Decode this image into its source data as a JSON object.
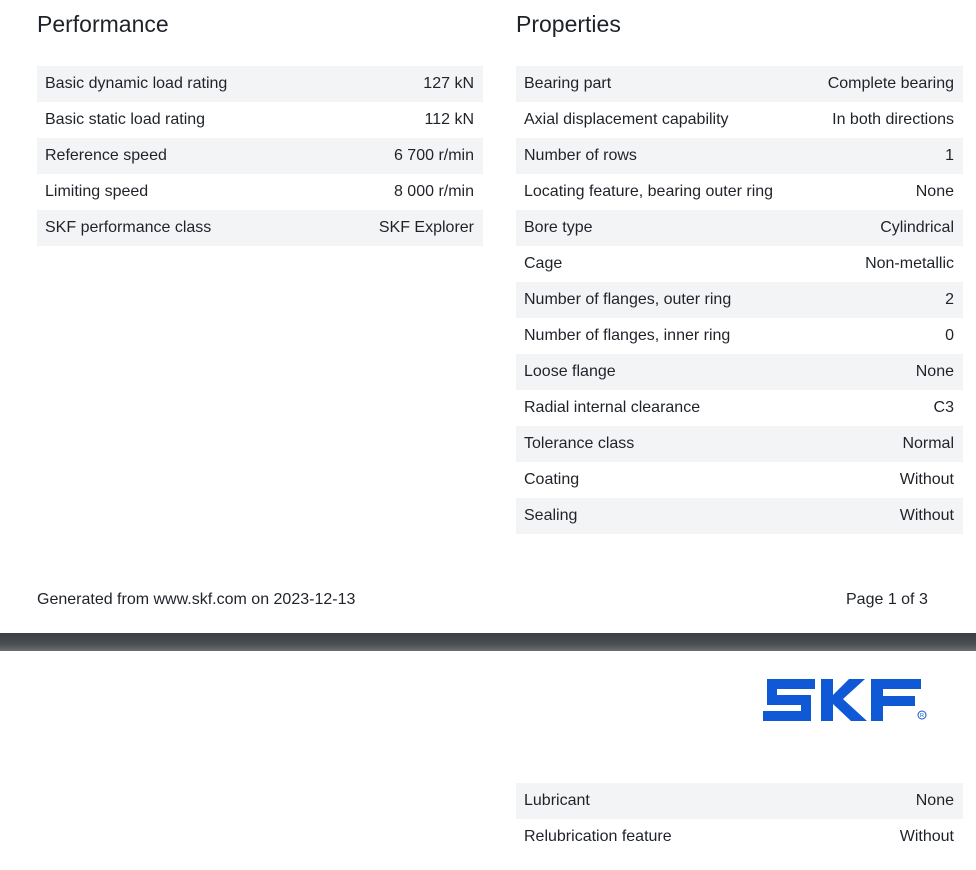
{
  "performance": {
    "title": "Performance",
    "rows": [
      {
        "label": "Basic dynamic load rating",
        "value": "127 kN"
      },
      {
        "label": "Basic static load rating",
        "value": "112 kN"
      },
      {
        "label": "Reference speed",
        "value": "6 700 r/min"
      },
      {
        "label": "Limiting speed",
        "value": "8 000 r/min"
      },
      {
        "label": "SKF performance class",
        "value": "SKF Explorer"
      }
    ]
  },
  "properties": {
    "title": "Properties",
    "rows": [
      {
        "label": "Bearing part",
        "value": "Complete bearing"
      },
      {
        "label": "Axial displacement capability",
        "value": "In both directions"
      },
      {
        "label": "Number of rows",
        "value": "1"
      },
      {
        "label": "Locating feature, bearing outer ring",
        "value": "None"
      },
      {
        "label": "Bore type",
        "value": "Cylindrical"
      },
      {
        "label": "Cage",
        "value": "Non-metallic"
      },
      {
        "label": "Number of flanges, outer ring",
        "value": "2"
      },
      {
        "label": "Number of flanges, inner ring",
        "value": "0"
      },
      {
        "label": "Loose flange",
        "value": "None"
      },
      {
        "label": "Radial internal clearance",
        "value": "C3"
      },
      {
        "label": "Tolerance class",
        "value": "Normal"
      },
      {
        "label": "Coating",
        "value": "Without"
      },
      {
        "label": "Sealing",
        "value": "Without"
      }
    ],
    "continued_rows": [
      {
        "label": "Lubricant",
        "value": "None"
      },
      {
        "label": "Relubrication feature",
        "value": "Without"
      }
    ]
  },
  "footer": {
    "generated": "Generated from www.skf.com on 2023-12-13",
    "page": "Page 1 of 3"
  },
  "logo": {
    "text": "SKF",
    "color": "#0f58d6"
  },
  "colors": {
    "row_shade": "#f3f4f5",
    "separator": "#3b3f44",
    "text": "#1f2329"
  }
}
